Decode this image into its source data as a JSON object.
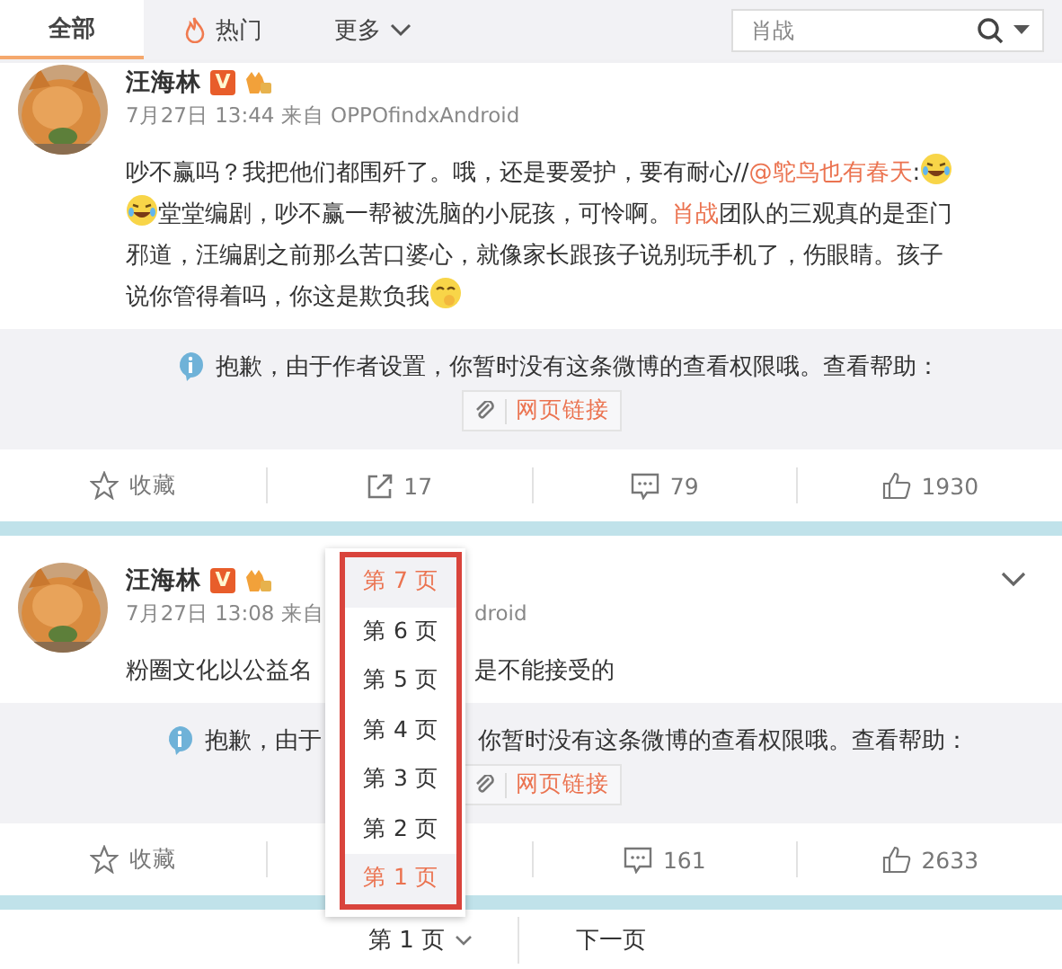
{
  "tabs": [
    {
      "label": "全部",
      "selected": true
    },
    {
      "label": "热门",
      "selected": false
    },
    {
      "label": "更多",
      "selected": false
    }
  ],
  "search": {
    "placeholder": "肖战"
  },
  "posts": [
    {
      "avatar": {
        "kind": "picture"
      },
      "name": "汪海林",
      "badge": "V",
      "meta_left": "7月27日 13:44 来自 OPPOfindxAndroid",
      "expand_menu": false,
      "lines": [
        [
          {
            "kind": "text",
            "text": "吵不赢吗？我把他们都围歼了。哦，还是要爱护，要有耐心//"
          },
          {
            "kind": "mention",
            "text": "@鸵鸟也有春天"
          },
          {
            "kind": "text",
            "text": ":"
          },
          {
            "kind": "emoji"
          }
        ],
        [
          {
            "kind": "emoji"
          },
          {
            "kind": "text",
            "text": "堂堂编剧，吵不赢一帮被洗脑的小屁孩，可怜啊。"
          },
          {
            "kind": "mention",
            "text": "肖战"
          },
          {
            "kind": "text",
            "text": "团队的三观真的是歪门"
          }
        ],
        [
          {
            "kind": "text",
            "text": "邪道，汪编剧之前那么苦口婆心，就像家长跟孩子说别玩手机了，伤眼睛。孩子"
          }
        ],
        [
          {
            "kind": "text",
            "text": "说你管得着吗，你这是欺负我"
          },
          {
            "kind": "shy"
          }
        ]
      ],
      "notice_left": "抱歉，由于作者设置，你暂时没有这条微博的查看权限哦。查看帮助：",
      "link": "网页链接",
      "actions": [
        {
          "kind": "favorite",
          "label": "收藏"
        },
        {
          "kind": "share",
          "label": "17"
        },
        {
          "kind": "comment",
          "label": "79"
        },
        {
          "kind": "like",
          "label": "1930"
        }
      ]
    },
    {
      "avatar": {
        "kind": "picture"
      },
      "name": "汪海林",
      "badge": "V",
      "meta_left": "7月27日 13:08 来自",
      "meta_right": "droid",
      "expand_menu": true,
      "lines": [
        [
          {
            "kind": "text",
            "text": "粉圈文化以公益名"
          }
        ]
      ],
      "body_right": "是不能接受的",
      "notice_left": "抱歉，由于",
      "notice_right": "你暂时没有这条微博的查看权限哦。查看帮助：",
      "link": "网页链接",
      "actions": [
        {
          "kind": "favorite",
          "label": "收藏"
        },
        {
          "kind": "comment",
          "label": "161"
        },
        {
          "kind": "like",
          "label": "2633"
        }
      ]
    }
  ],
  "pager": {
    "current": "第 1 页",
    "next": "下一页"
  },
  "page_menu": [
    {
      "label": "第 7 页",
      "highlighted": true
    },
    {
      "label": "第 6 页",
      "highlighted": false
    },
    {
      "label": "第 5 页",
      "highlighted": false
    },
    {
      "label": "第 4 页",
      "highlighted": false
    },
    {
      "label": "第 3 页",
      "highlighted": false
    },
    {
      "label": "第 2 页",
      "highlighted": false
    },
    {
      "label": "第 1 页",
      "highlighted": true
    }
  ]
}
